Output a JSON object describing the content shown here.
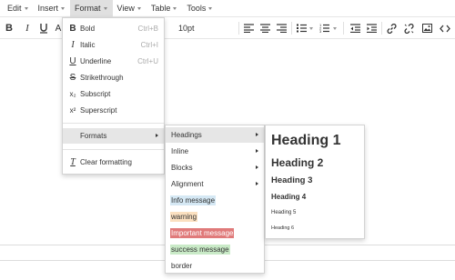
{
  "menubar": {
    "items": [
      "Edit",
      "Insert",
      "Format",
      "View",
      "Table",
      "Tools"
    ]
  },
  "toolbar": {
    "font_size": "10pt"
  },
  "format_menu": {
    "bold": {
      "label": "Bold",
      "shortcut": "Ctrl+B",
      "icon": "B"
    },
    "italic": {
      "label": "Italic",
      "shortcut": "Ctrl+I",
      "icon": "I"
    },
    "underline": {
      "label": "Underline",
      "shortcut": "Ctrl+U",
      "icon": "U"
    },
    "strikethrough": {
      "label": "Strikethrough",
      "icon": "S"
    },
    "subscript": {
      "label": "Subscript",
      "icon": "x₂"
    },
    "superscript": {
      "label": "Superscript",
      "icon": "x²"
    },
    "formats": {
      "label": "Formats"
    },
    "clear": {
      "label": "Clear formatting",
      "icon": "T"
    }
  },
  "formats_menu": {
    "headings": "Headings",
    "inline": "Inline",
    "blocks": "Blocks",
    "alignment": "Alignment",
    "info": {
      "label": "Info message",
      "bg": "#d5e8f4"
    },
    "warning": {
      "label": "warning",
      "bg": "#fbe0c0"
    },
    "important": {
      "label": "Important message",
      "bg": "#e07a7a",
      "color": "#ffffff"
    },
    "success": {
      "label": "success message",
      "bg": "#c9eac7"
    },
    "border": {
      "label": "border"
    }
  },
  "headings_menu": {
    "h1": "Heading 1",
    "h2": "Heading 2",
    "h3": "Heading 3",
    "h4": "Heading 4",
    "h5": "Heading 5",
    "h6": "Heading 6"
  }
}
